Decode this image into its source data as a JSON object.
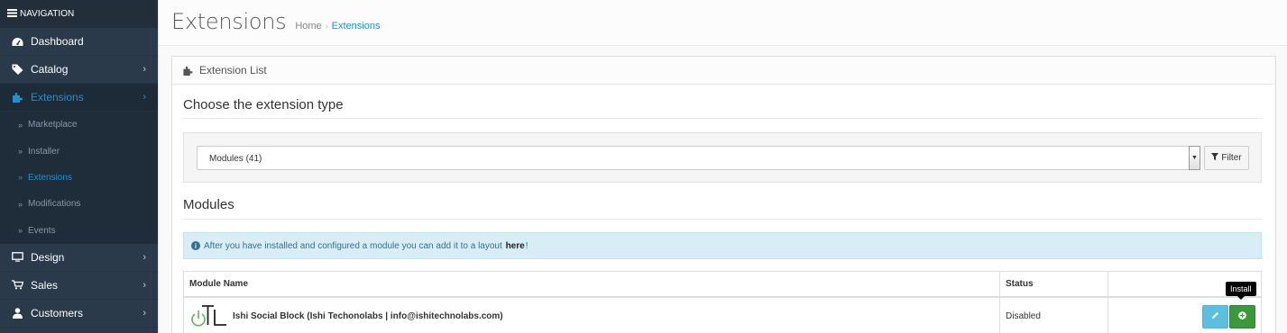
{
  "navigation": {
    "header": "NAVIGATION",
    "items": [
      {
        "label": "Dashboard",
        "icon": "dashboard-icon"
      },
      {
        "label": "Catalog",
        "icon": "tag-icon"
      },
      {
        "label": "Extensions",
        "icon": "puzzle-icon"
      },
      {
        "label": "Design",
        "icon": "monitor-icon"
      },
      {
        "label": "Sales",
        "icon": "cart-icon"
      },
      {
        "label": "Customers",
        "icon": "user-icon"
      }
    ],
    "submenu": [
      "Marketplace",
      "Installer",
      "Extensions",
      "Modifications",
      "Events"
    ]
  },
  "page": {
    "title": "Extensions",
    "breadcrumb": [
      "Home",
      "Extensions"
    ]
  },
  "panel": {
    "heading": "Extension List",
    "choose_title": "Choose the extension type",
    "select_value": "Modules (41)",
    "filter_label": "Filter",
    "modules_title": "Modules",
    "alert_text_before": "After you have installed and configured a module you can add it to a layout",
    "alert_link": "here",
    "alert_text_after": "!"
  },
  "table": {
    "headers": [
      "Module Name",
      "Status",
      ""
    ],
    "rows": [
      {
        "name": "Ishi Social Block (Ishi Techonolabs | info@ishitechnolabs.com)",
        "status": "Disabled"
      }
    ]
  },
  "tooltip": "Install",
  "colors": {
    "sidebar_bg": "#2a3a4a",
    "accent": "#1e91cf",
    "install": "#3a9a3a",
    "edit": "#5bc0de",
    "alert_bg": "#d9edf7"
  }
}
